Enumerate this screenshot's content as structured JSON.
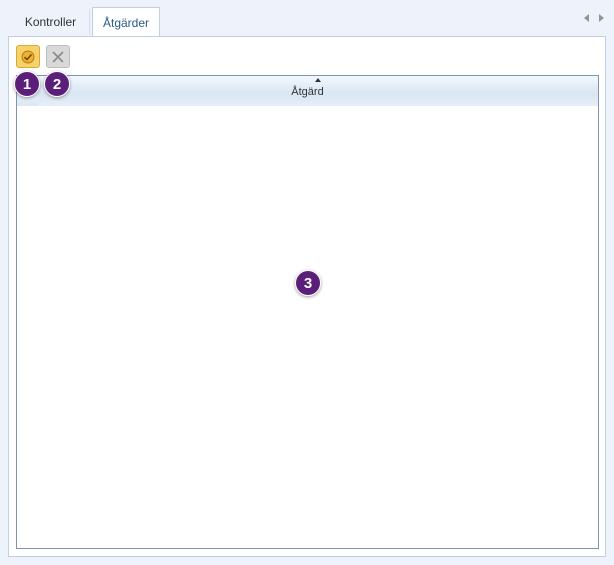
{
  "tabs": [
    {
      "label": "Kontroller",
      "active": false
    },
    {
      "label": "Åtgärder",
      "active": true
    }
  ],
  "toolbar": {
    "approve_icon": "approve-action-icon",
    "remove_icon": "close-icon"
  },
  "grid": {
    "column_header": "Åtgärd",
    "sort": "ascending",
    "rows": []
  },
  "markers": [
    "1",
    "2",
    "3"
  ],
  "colors": {
    "accent": "#5b1f79",
    "header_bg": "#d9e6f4",
    "approve_button": "#f7d26b"
  }
}
